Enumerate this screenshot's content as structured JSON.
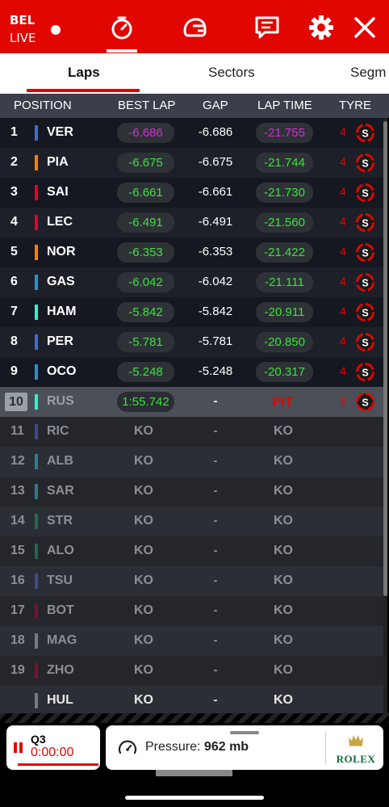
{
  "header": {
    "session_line1": "BEL",
    "session_line2": "LIVE",
    "icons": [
      "timer-icon",
      "helmet-icon",
      "chat-icon",
      "gear-icon",
      "close-icon"
    ]
  },
  "tabs": [
    {
      "label": "Laps",
      "active": true
    },
    {
      "label": "Sectors",
      "active": false
    },
    {
      "label": "Segm",
      "active": false
    }
  ],
  "columns": [
    "POSITION",
    "BEST LAP",
    "GAP",
    "LAP TIME",
    "TYRE"
  ],
  "colors": {
    "accent": "#e10600",
    "purple": "#d82ad8",
    "green": "#3ee03e",
    "tyre_red": "#e10600",
    "ko_gray": "#8c8f96"
  },
  "rows": [
    {
      "pos": "1",
      "code": "VER",
      "team_color": "#3a6fd6",
      "best": "-6.686",
      "best_color": "purple",
      "gap": "-6.686",
      "lap": "-21.755",
      "lap_color": "purple",
      "tyre_laps": "4",
      "tyre": "S"
    },
    {
      "pos": "2",
      "code": "PIA",
      "team_color": "#ff8000",
      "best": "-6.675",
      "best_color": "green",
      "gap": "-6.675",
      "lap": "-21.744",
      "lap_color": "green",
      "tyre_laps": "4",
      "tyre": "S"
    },
    {
      "pos": "3",
      "code": "SAI",
      "team_color": "#e8002d",
      "best": "-6.661",
      "best_color": "green",
      "gap": "-6.661",
      "lap": "-21.730",
      "lap_color": "green",
      "tyre_laps": "4",
      "tyre": "S"
    },
    {
      "pos": "4",
      "code": "LEC",
      "team_color": "#e8002d",
      "best": "-6.491",
      "best_color": "green",
      "gap": "-6.491",
      "lap": "-21.560",
      "lap_color": "green",
      "tyre_laps": "4",
      "tyre": "S"
    },
    {
      "pos": "5",
      "code": "NOR",
      "team_color": "#ff8000",
      "best": "-6.353",
      "best_color": "green",
      "gap": "-6.353",
      "lap": "-21.422",
      "lap_color": "green",
      "tyre_laps": "4",
      "tyre": "S"
    },
    {
      "pos": "6",
      "code": "GAS",
      "team_color": "#2293d1",
      "best": "-6.042",
      "best_color": "green",
      "gap": "-6.042",
      "lap": "-21.111",
      "lap_color": "green",
      "tyre_laps": "4",
      "tyre": "S"
    },
    {
      "pos": "7",
      "code": "HAM",
      "team_color": "#27f4d2",
      "best": "-5.842",
      "best_color": "green",
      "gap": "-5.842",
      "lap": "-20.911",
      "lap_color": "green",
      "tyre_laps": "4",
      "tyre": "S"
    },
    {
      "pos": "8",
      "code": "PER",
      "team_color": "#3a6fd6",
      "best": "-5.781",
      "best_color": "green",
      "gap": "-5.781",
      "lap": "-20.850",
      "lap_color": "green",
      "tyre_laps": "4",
      "tyre": "S"
    },
    {
      "pos": "9",
      "code": "OCO",
      "team_color": "#2293d1",
      "best": "-5.248",
      "best_color": "green",
      "gap": "-5.248",
      "lap": "-20.317",
      "lap_color": "green",
      "tyre_laps": "4",
      "tyre": "S"
    },
    {
      "pos": "10",
      "code": "RUS",
      "team_color": "#27f4d2",
      "best": "1:55.742",
      "best_color": "green",
      "gap": "-",
      "lap": "PIT",
      "lap_color": "red",
      "tyre_laps": "3",
      "tyre": "S",
      "highlight": true
    },
    {
      "pos": "11",
      "code": "RIC",
      "team_color": "#4b6bd6",
      "best": "KO",
      "gap": "-",
      "lap": "KO",
      "out": true
    },
    {
      "pos": "12",
      "code": "ALB",
      "team_color": "#37bedd",
      "best": "KO",
      "gap": "-",
      "lap": "KO",
      "out": true
    },
    {
      "pos": "13",
      "code": "SAR",
      "team_color": "#37bedd",
      "best": "KO",
      "gap": "-",
      "lap": "KO",
      "out": true
    },
    {
      "pos": "14",
      "code": "STR",
      "team_color": "#229971",
      "best": "KO",
      "gap": "-",
      "lap": "KO",
      "out": true
    },
    {
      "pos": "15",
      "code": "ALO",
      "team_color": "#229971",
      "best": "KO",
      "gap": "-",
      "lap": "KO",
      "out": true
    },
    {
      "pos": "16",
      "code": "TSU",
      "team_color": "#4b6bd6",
      "best": "KO",
      "gap": "-",
      "lap": "KO",
      "out": true
    },
    {
      "pos": "17",
      "code": "BOT",
      "team_color": "#c00030",
      "best": "KO",
      "gap": "-",
      "lap": "KO",
      "out": true
    },
    {
      "pos": "18",
      "code": "MAG",
      "team_color": "#b6babd",
      "best": "KO",
      "gap": "-",
      "lap": "KO",
      "out": true
    },
    {
      "pos": "19",
      "code": "ZHO",
      "team_color": "#c00030",
      "best": "KO",
      "gap": "-",
      "lap": "KO",
      "out": true
    },
    {
      "pos": "",
      "code": "HUL",
      "team_color": "#b6babd",
      "best": "KO",
      "gap": "-",
      "lap": "KO",
      "out": true,
      "white": true
    }
  ],
  "footer": {
    "session": "Q3",
    "clock": "0:00:00",
    "pressure_label": "Pressure:",
    "pressure_value": "962 mb",
    "sponsor": "ROLEX"
  }
}
